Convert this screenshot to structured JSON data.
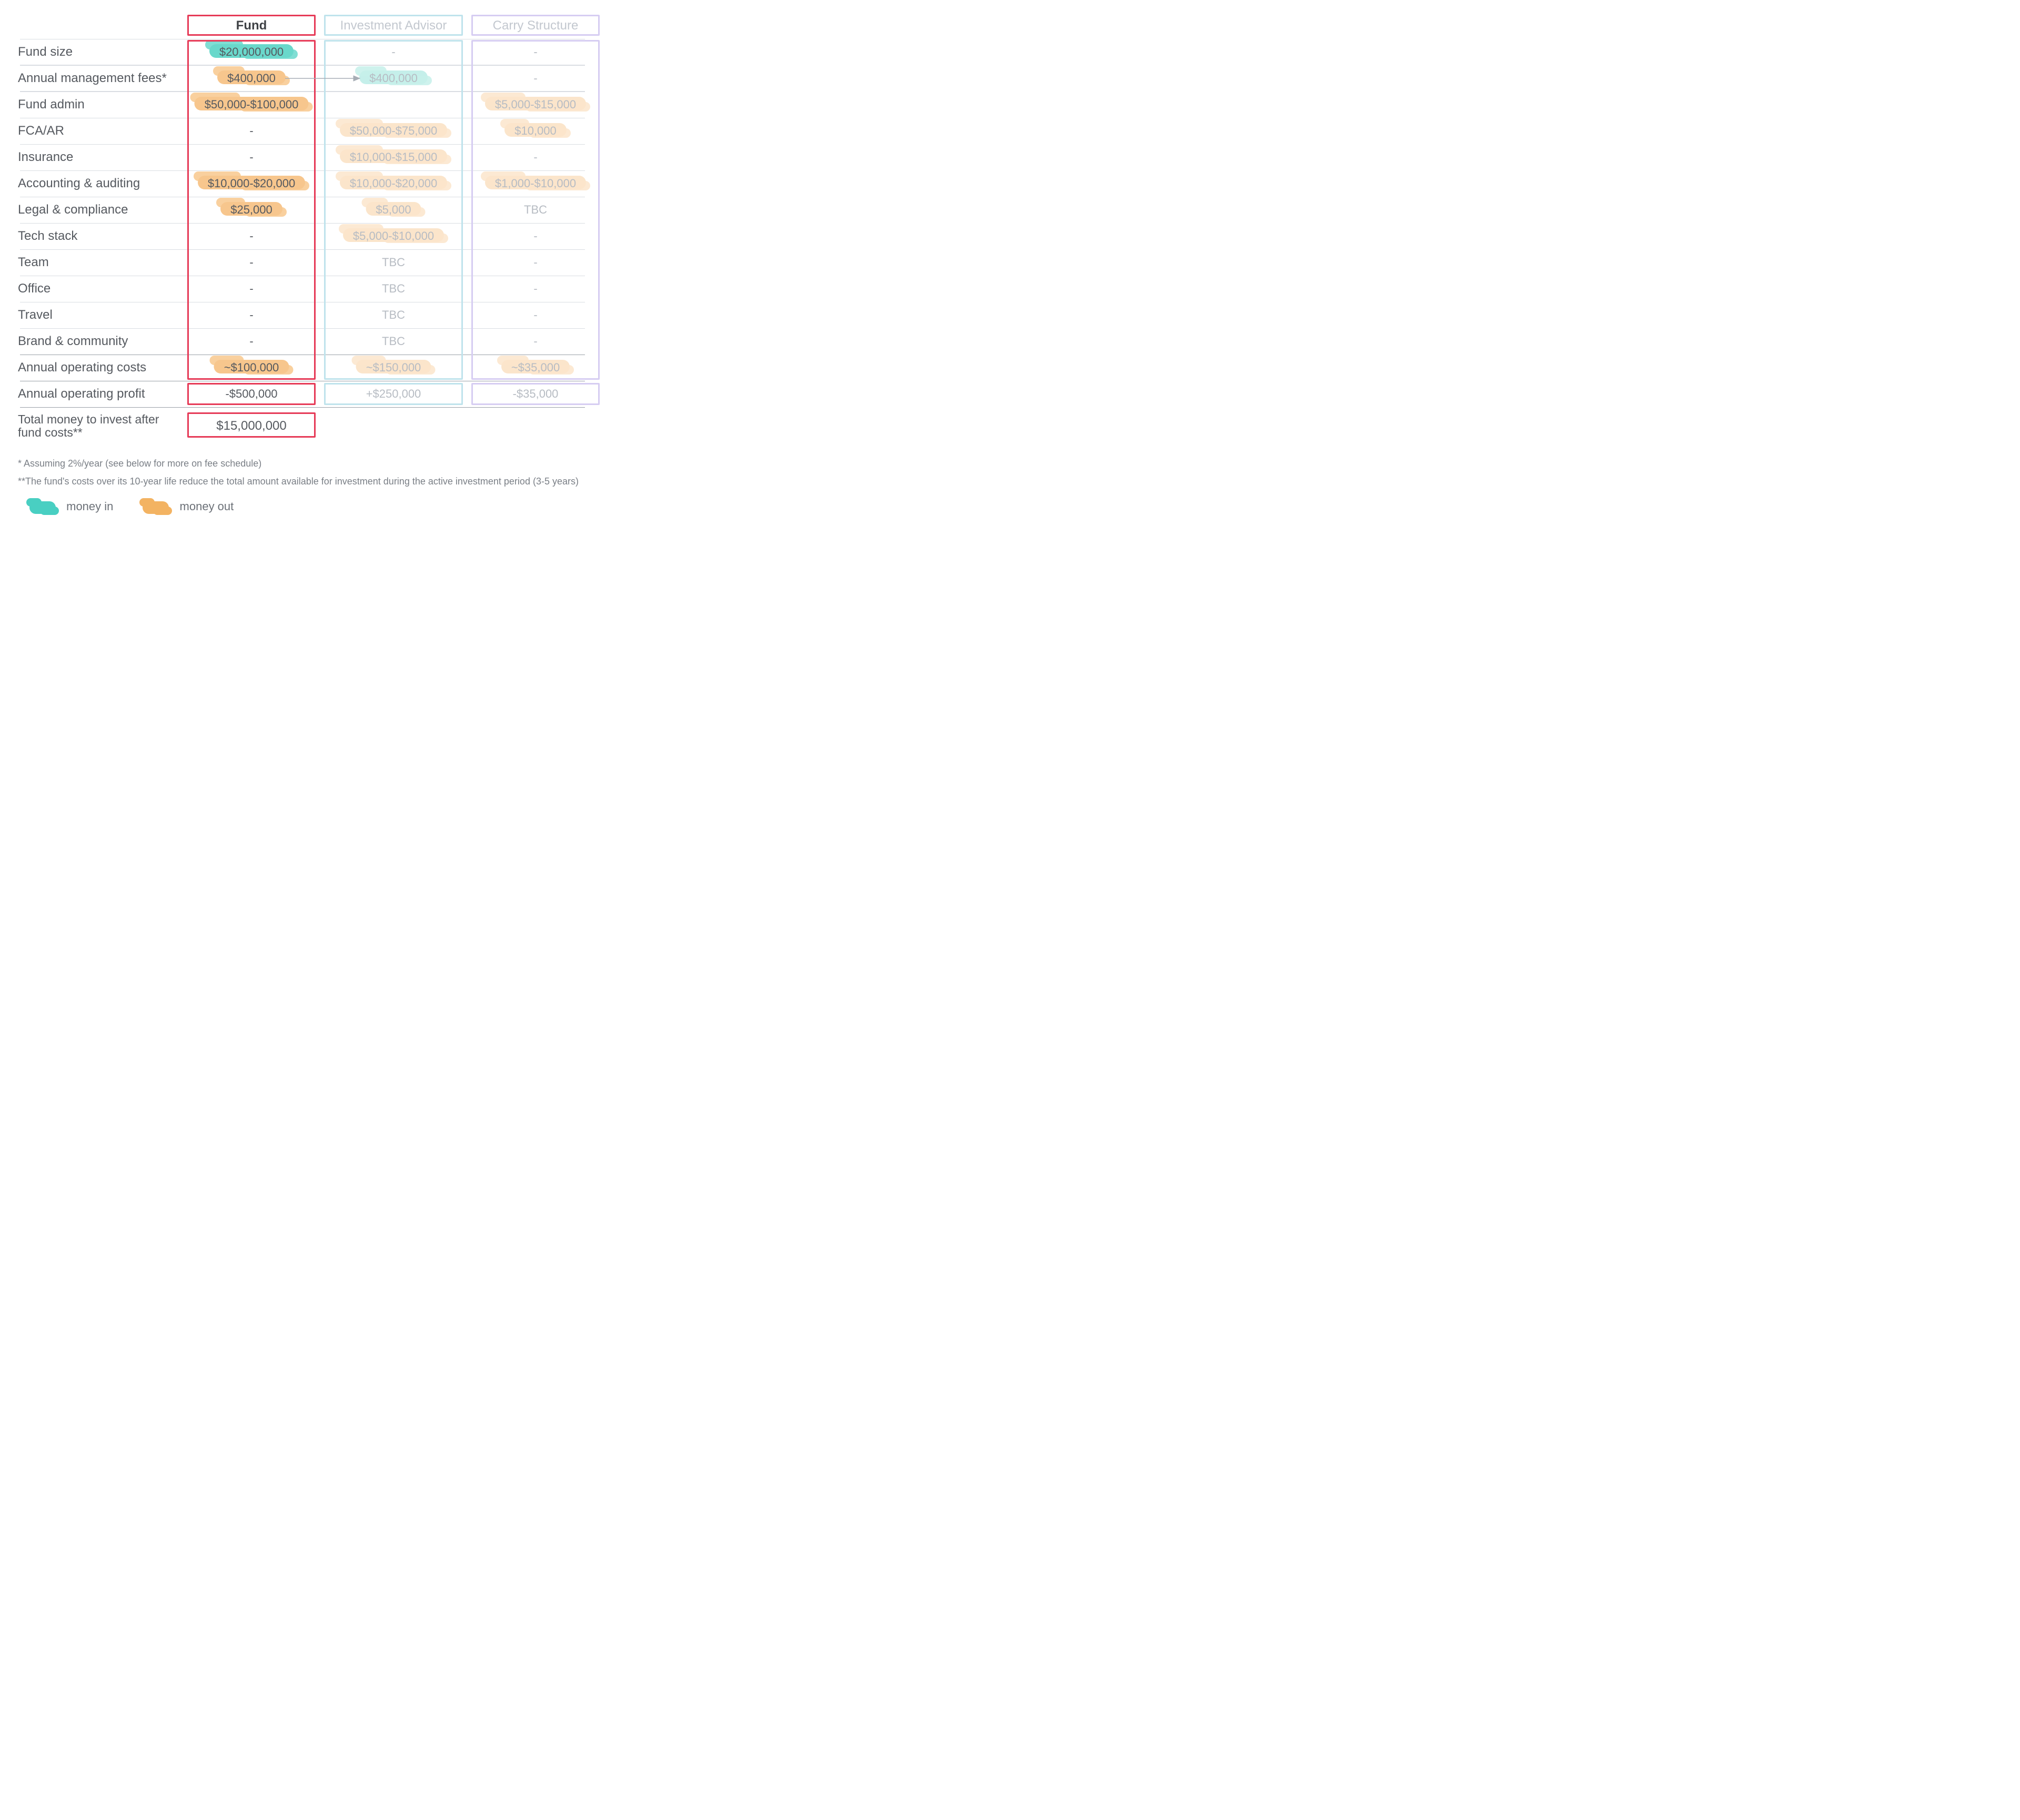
{
  "columns": {
    "fund": "Fund",
    "advisor": "Investment Advisor",
    "carry": "Carry Structure"
  },
  "rows": [
    {
      "label": "Fund size",
      "fund": "$20,000,000",
      "fund_hl": "teal",
      "advisor": "-",
      "advisor_hl": null,
      "carry": "-",
      "carry_hl": null
    },
    {
      "label": "Annual management fees*",
      "fund": "$400,000",
      "fund_hl": "orange",
      "advisor": "$400,000",
      "advisor_hl": "teal-faded",
      "carry": "-",
      "carry_hl": null
    },
    {
      "label": "Fund admin",
      "fund": "$50,000-$100,000",
      "fund_hl": "orange",
      "advisor": "",
      "advisor_hl": null,
      "carry": "$5,000-$15,000",
      "carry_hl": "orange-faded"
    },
    {
      "label": "FCA/AR",
      "fund": "-",
      "fund_hl": null,
      "advisor": "$50,000-$75,000",
      "advisor_hl": "orange-faded",
      "carry": "$10,000",
      "carry_hl": "orange-faded"
    },
    {
      "label": "Insurance",
      "fund": "-",
      "fund_hl": null,
      "advisor": "$10,000-$15,000",
      "advisor_hl": "orange-faded",
      "carry": "-",
      "carry_hl": null
    },
    {
      "label": "Accounting & auditing",
      "fund": "$10,000-$20,000",
      "fund_hl": "orange",
      "advisor": "$10,000-$20,000",
      "advisor_hl": "orange-faded",
      "carry": "$1,000-$10,000",
      "carry_hl": "orange-faded"
    },
    {
      "label": "Legal & compliance",
      "fund": "$25,000",
      "fund_hl": "orange",
      "advisor": "$5,000",
      "advisor_hl": "orange-faded",
      "carry": "TBC",
      "carry_hl": null
    },
    {
      "label": "Tech stack",
      "fund": "-",
      "fund_hl": null,
      "advisor": "$5,000-$10,000",
      "advisor_hl": "orange-faded",
      "carry": "-",
      "carry_hl": null
    },
    {
      "label": "Team",
      "fund": "-",
      "fund_hl": null,
      "advisor": "TBC",
      "advisor_hl": null,
      "carry": "-",
      "carry_hl": null
    },
    {
      "label": "Office",
      "fund": "-",
      "fund_hl": null,
      "advisor": "TBC",
      "advisor_hl": null,
      "carry": "-",
      "carry_hl": null
    },
    {
      "label": "Travel",
      "fund": "-",
      "fund_hl": null,
      "advisor": "TBC",
      "advisor_hl": null,
      "carry": "-",
      "carry_hl": null
    },
    {
      "label": "Brand & community",
      "fund": "-",
      "fund_hl": null,
      "advisor": "TBC",
      "advisor_hl": null,
      "carry": "-",
      "carry_hl": null
    },
    {
      "label": "Annual operating costs",
      "fund": "~$100,000",
      "fund_hl": "orange",
      "advisor": "~$150,000",
      "advisor_hl": "orange-faded",
      "carry": "~$35,000",
      "carry_hl": "orange-faded"
    }
  ],
  "profit_row": {
    "label": "Annual operating profit",
    "fund": "-$500,000",
    "advisor": "+$250,000",
    "carry": "-$35,000"
  },
  "total_row": {
    "label": "Total money to invest after fund costs**",
    "fund": "$15,000,000"
  },
  "footnotes": {
    "f1": "* Assuming 2%/year (see below for more on fee schedule)",
    "f2": "**The fund's costs over its 10-year life reduce the total amount available for investment during the active investment period (3-5 years)"
  },
  "legend": {
    "money_in": "money in",
    "money_out": "money out"
  }
}
